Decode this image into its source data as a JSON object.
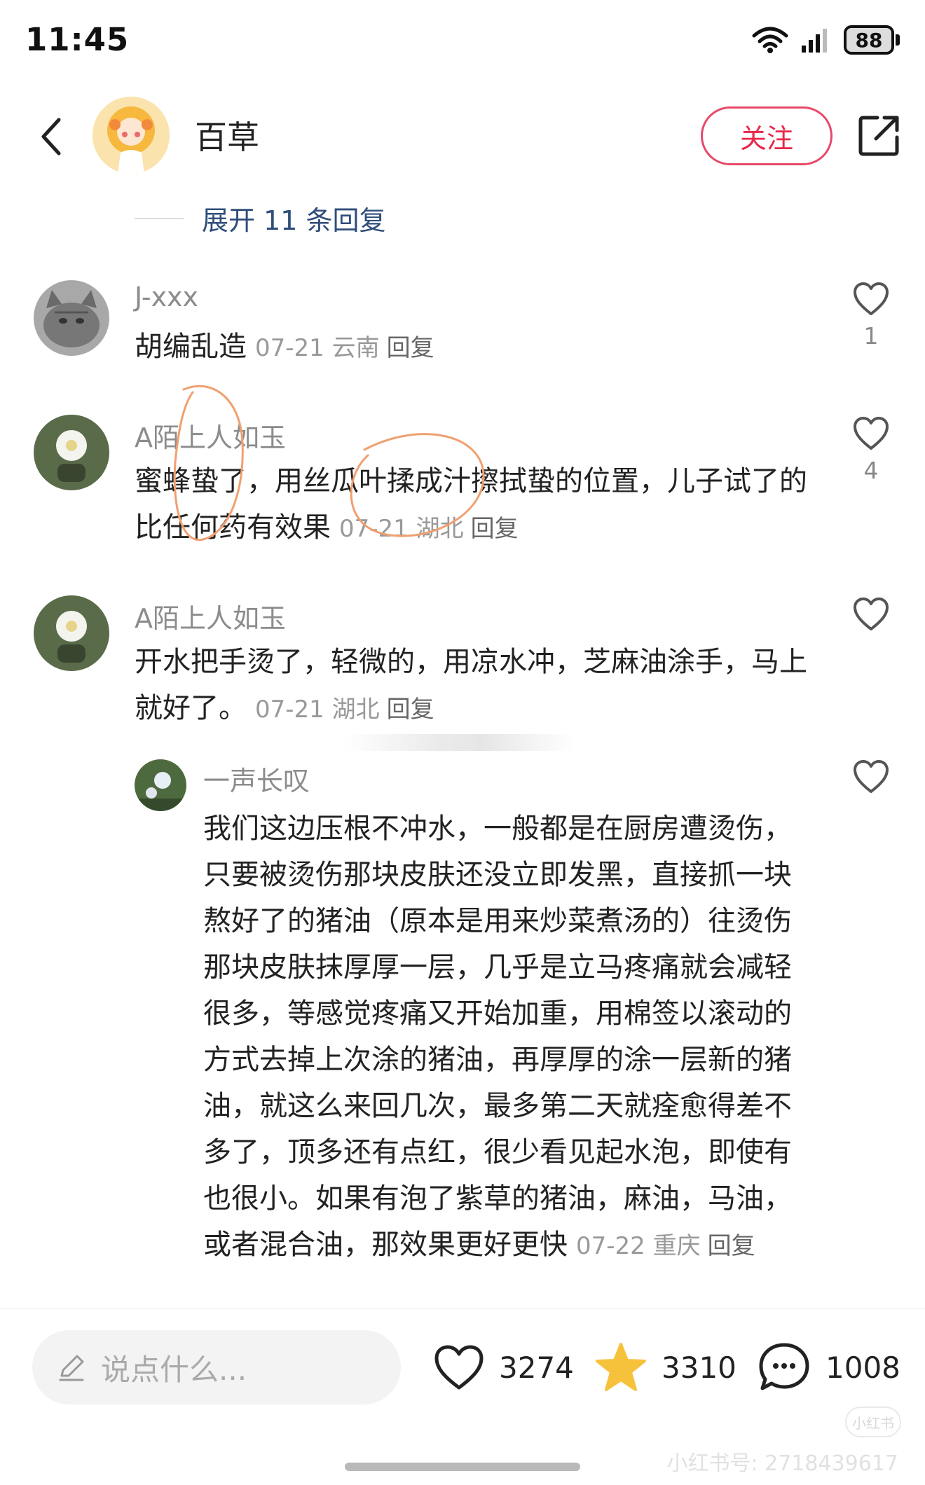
{
  "status_bar": {
    "time": "11:45",
    "battery": "88"
  },
  "header": {
    "author": "百草",
    "follow_label": "关注"
  },
  "expand_replies": "展开 11 条回复",
  "comments": [
    {
      "name": "J-xxx",
      "text": "胡编乱造",
      "date": "07-21",
      "location": "云南",
      "reply": "回复",
      "likes": "1"
    },
    {
      "name": "A陌上人如玉",
      "text": "蜜蜂蛰了，用丝瓜叶揉成汁擦拭蛰的位置，儿子试了的比任何药有效果",
      "date": "07-21",
      "location": "湖北",
      "reply": "回复",
      "likes": "4"
    },
    {
      "name": "A陌上人如玉",
      "text": "开水把手烫了，轻微的，用凉水冲，芝麻油涂手，马上就好了。",
      "date": "07-21",
      "location": "湖北",
      "reply": "回复",
      "likes": ""
    },
    {
      "name": "一声长叹",
      "text": "我们这边压根不冲水，一般都是在厨房遭烫伤，只要被烫伤那块皮肤还没立即发黑，直接抓一块熬好了的猪油（原本是用来炒菜煮汤的）往烫伤那块皮肤抹厚厚一层，几乎是立马疼痛就会减轻很多，等感觉疼痛又开始加重，用棉签以滚动的方式去掉上次涂的猪油，再厚厚的涂一层新的猪油，就这么来回几次，最多第二天就痊愈得差不多了，顶多还有点红，很少看见起水泡，即使有也很小。如果有泡了紫草的猪油，麻油，马油，或者混合油，那效果更好更快",
      "date": "07-22",
      "location": "重庆",
      "reply": "回复",
      "likes": ""
    }
  ],
  "bottom_bar": {
    "input_placeholder": "说点什么...",
    "likes": "3274",
    "collects": "3310",
    "comments": "1008"
  },
  "watermark": "小红书号: 2718439617",
  "watermark_logo": "小红书",
  "colors": {
    "follow": "#e8284a",
    "expand_link": "#2f4e7a",
    "annotation": "#f0a070",
    "star": "#f7c23b"
  }
}
